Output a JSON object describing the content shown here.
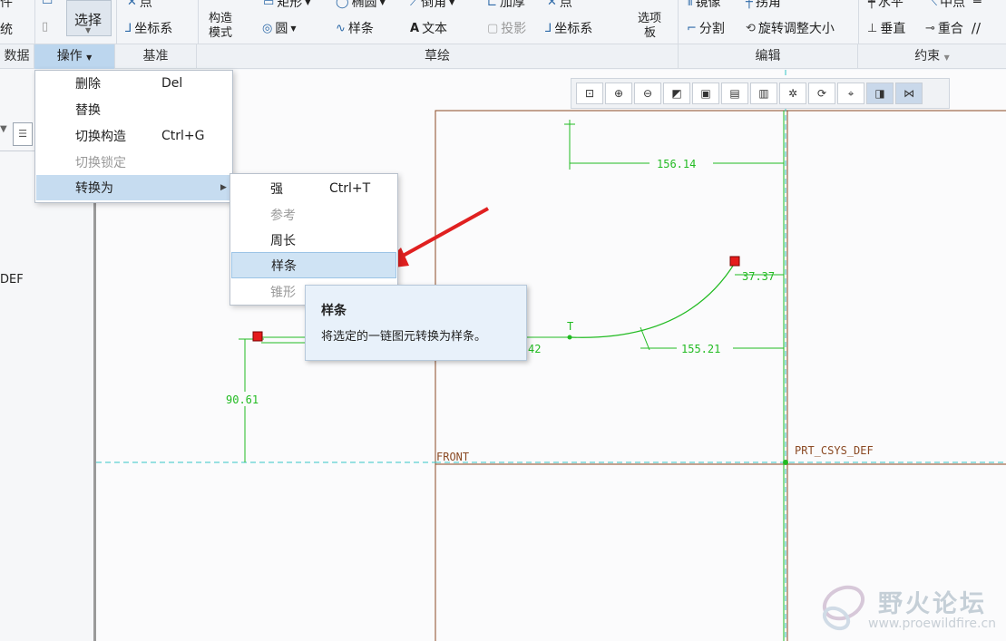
{
  "ribbon": {
    "row1": [
      "件",
      "选择",
      "点",
      "矩形",
      "椭圆",
      "倒角",
      "加厚",
      "点",
      "镜像",
      "拐角",
      "水平",
      "中点"
    ],
    "row2": [
      "统",
      "坐标系",
      "模式",
      "圆",
      "样条",
      "文本",
      "投影",
      "坐标系",
      "分割",
      "旋转调整大小",
      "垂直",
      "重合"
    ],
    "construct_top": "构造",
    "options_top": "选项",
    "options_bottom": "板",
    "select_label": "选择"
  },
  "groups": [
    "数据",
    "操作",
    "基准",
    "草绘",
    "编辑",
    "约束"
  ],
  "menu_operation": [
    {
      "label": "删除",
      "shortcut": "Del"
    },
    {
      "label": "替换",
      "shortcut": ""
    },
    {
      "label": "切换构造",
      "shortcut": "Ctrl+G"
    },
    {
      "label": "切换锁定",
      "shortcut": ""
    },
    {
      "label": "转换为",
      "shortcut": ""
    }
  ],
  "menu_convert": [
    {
      "label": "强",
      "shortcut": "Ctrl+T"
    },
    {
      "label": "参考",
      "shortcut": ""
    },
    {
      "label": "周长",
      "shortcut": ""
    },
    {
      "label": "样条",
      "shortcut": ""
    },
    {
      "label": "锥形",
      "shortcut": ""
    }
  ],
  "tooltip": {
    "title": "样条",
    "body": "将选定的一链图元转换为样条。"
  },
  "left_panel": {
    "def_text": "DEF"
  },
  "sketch": {
    "dims": [
      "156.14",
      "37.37",
      "155.21",
      "90.61",
      "42"
    ],
    "front_label": "FRONT",
    "csys_label": "PRT_CSYS_DEF",
    "tangent_label": "T"
  },
  "watermark": {
    "name": "野火论坛",
    "url": "www.proewildfire.cn"
  },
  "colors": {
    "accent": "#2e6aa8",
    "sketch": "#22bb22",
    "highlight": "#c6dcf0",
    "frame": "#8b4a24",
    "axis": "#36c6c6"
  }
}
